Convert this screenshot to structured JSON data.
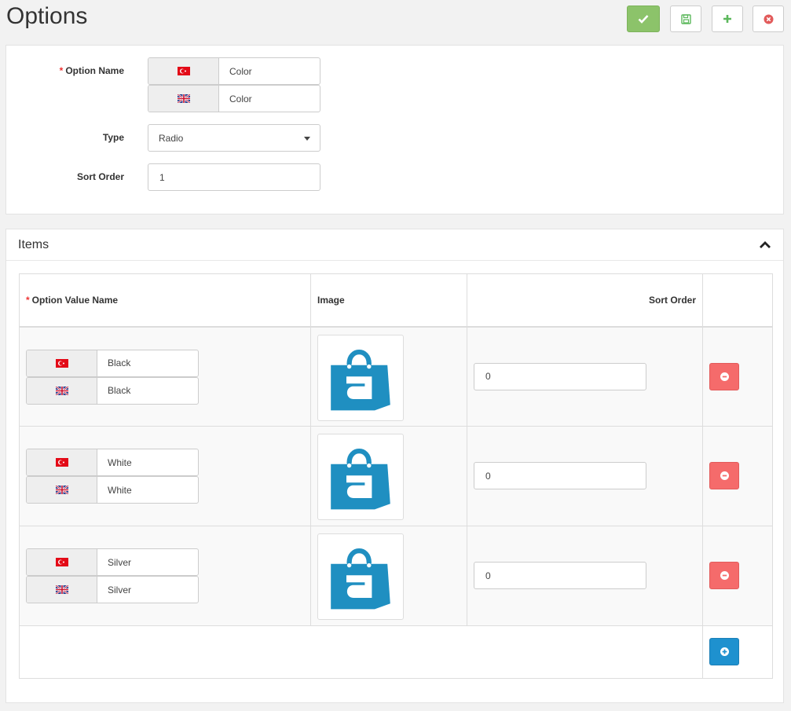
{
  "page": {
    "title": "Options"
  },
  "toolbar": {
    "save_close_icon": "check-icon",
    "save_icon": "floppy-icon",
    "add_icon": "plus-icon",
    "cancel_icon": "times-circle-icon",
    "colors": {
      "green": "#8cc36a",
      "danger": "#f56b6b",
      "primary": "#1e91cf"
    }
  },
  "form": {
    "option_name_label": "Option Name",
    "required_mark": "*",
    "option_name_values": [
      {
        "flag": "tr-flag-icon",
        "value": "Color"
      },
      {
        "flag": "gb-flag-icon",
        "value": "Color"
      }
    ],
    "type_label": "Type",
    "type_value": "Radio",
    "sort_order_label": "Sort Order",
    "sort_order_value": "1"
  },
  "items": {
    "title": "Items",
    "columns": {
      "option_value_name": "Option Value Name",
      "image": "Image",
      "sort_order": "Sort Order"
    },
    "rows": [
      {
        "names": [
          "Black",
          "Black"
        ],
        "sort_order": "0"
      },
      {
        "names": [
          "White",
          "White"
        ],
        "sort_order": "0"
      },
      {
        "names": [
          "Silver",
          "Silver"
        ],
        "sort_order": "0"
      }
    ]
  }
}
